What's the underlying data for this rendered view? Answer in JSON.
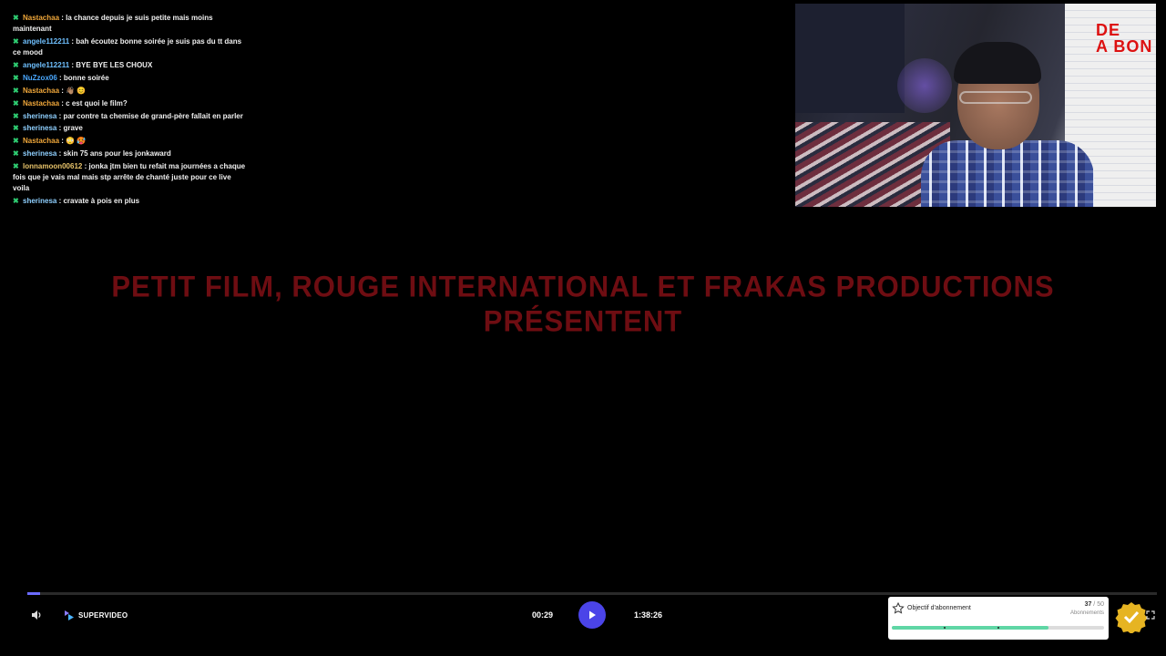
{
  "chat": [
    {
      "user": "Nastachaa",
      "text": "la chance depuis je suis petite mais moins maintenant",
      "color": "#f0a73a"
    },
    {
      "user": "angele112211",
      "text": "bah écoutez bonne soirée je suis pas du tt dans ce mood",
      "color": "#6fc0ff"
    },
    {
      "user": "angele112211",
      "text": "BYE BYE LES CHOUX",
      "color": "#6fc0ff"
    },
    {
      "user": "NuZzox06",
      "text": "bonne soirée",
      "color": "#4aa8ff"
    },
    {
      "user": "Nastachaa",
      "text": "👋🏽 😊",
      "color": "#f0a73a"
    },
    {
      "user": "Nastachaa",
      "text": "c est quoi le film?",
      "color": "#f0a73a"
    },
    {
      "user": "sherinesa",
      "text": "par contre ta chemise de grand-père fallait en parler",
      "color": "#8fd0ff"
    },
    {
      "user": "sherinesa",
      "text": "grave",
      "color": "#8fd0ff"
    },
    {
      "user": "Nastachaa",
      "text": "😳 🥵",
      "color": "#f0a73a"
    },
    {
      "user": "sherinesa",
      "text": "skin 75 ans pour les jonkaward",
      "color": "#8fd0ff"
    },
    {
      "user": "lonnamoon00612",
      "text": "jonka jtm bien tu refait ma journées a chaque fois que je vais mal mais stp arrête de chanté juste pour ce live voila",
      "color": "#e8c36a"
    },
    {
      "user": "sherinesa",
      "text": "cravate à pois en plus",
      "color": "#8fd0ff"
    }
  ],
  "webcam": {
    "board_text": "DE\nA BON"
  },
  "film_title": {
    "line1": "Petit film, Rouge International et Frakas Productions",
    "line2": "présentent"
  },
  "player": {
    "brand": "SUPERVIDEO",
    "current_time": "00:29",
    "total_time": "1:38:26",
    "progress": 0.011,
    "accent": "#4b44e8"
  },
  "sub_goal": {
    "title": "Objectif d'abonnement",
    "current": "37",
    "separator": " / ",
    "target": "50",
    "unit": "Abonnements",
    "progress": 0.74
  }
}
